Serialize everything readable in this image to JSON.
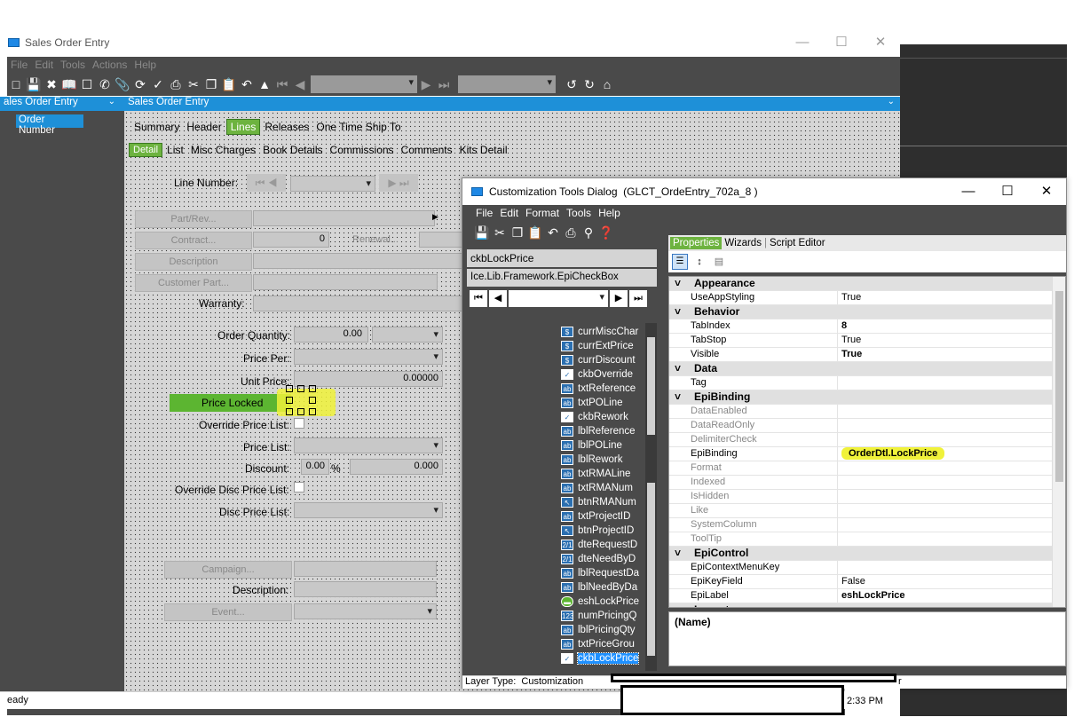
{
  "main_window": {
    "title": "Sales Order Entry",
    "menu": [
      "File",
      "Edit",
      "Tools",
      "Actions",
      "Help"
    ],
    "status_left": "eady"
  },
  "tree_panel": {
    "header": "ales Order Entry",
    "item": "Order Number"
  },
  "content_header": "Sales Order Entry",
  "tabs_top": [
    {
      "label": "Summary",
      "active": false
    },
    {
      "label": "Header",
      "active": false
    },
    {
      "label": "Lines",
      "active": true
    },
    {
      "label": "Releases",
      "active": false
    },
    {
      "label": "One Time Ship To",
      "active": false
    }
  ],
  "tabs_sub": [
    {
      "label": "Detail",
      "active": true
    },
    {
      "label": "List",
      "active": false
    },
    {
      "label": "Misc Charges",
      "active": false
    },
    {
      "label": "Book Details",
      "active": false
    },
    {
      "label": "Commissions",
      "active": false
    },
    {
      "label": "Comments",
      "active": false
    },
    {
      "label": "Kits Detail",
      "active": false
    }
  ],
  "form": {
    "line_number_label": "Line Number:",
    "part_rev_btn": "Part/Rev...",
    "contract_btn": "Contract...",
    "contract_value": "0",
    "renewal_btn": "Renewal...",
    "description_btn": "Description",
    "customer_part_btn": "Customer Part...",
    "warranty_label": "Warranty:",
    "order_qty_label": "Order Quantity:",
    "order_qty_value": "0.00",
    "price_per_label": "Price Per:",
    "unit_price_label": "Unit Price:",
    "unit_price_value": "0.00000",
    "price_locked": "Price Locked",
    "override_price_list_label": "Override Price List:",
    "price_list_label": "Price List:",
    "discount_label": "Discount:",
    "discount_pct": "0.00",
    "discount_pct_sign": "%",
    "discount_value": "0.000",
    "override_disc_label": "Override Disc Price List:",
    "disc_price_list_label": "Disc Price List:",
    "campaign_btn": "Campaign...",
    "description_label": "Description:",
    "event_btn": "Event..."
  },
  "dialog": {
    "title": "Customization Tools Dialog  (GLCT_OrdeEntry_702a_8 )",
    "menu": [
      "File",
      "Edit",
      "Format",
      "Tools",
      "Help"
    ],
    "control_name": "ckbLockPrice",
    "control_type": "Ice.Lib.Framework.EpiCheckBox",
    "tabs": [
      {
        "label": "Properties",
        "active": true
      },
      {
        "label": "Wizards",
        "active": false
      },
      {
        "label": "Script Editor",
        "active": false
      }
    ],
    "tree": [
      {
        "icon": "$",
        "label": "currMiscChar"
      },
      {
        "icon": "$",
        "label": "currExtPrice"
      },
      {
        "icon": "$",
        "label": "currDiscount"
      },
      {
        "icon": "✓",
        "label": "ckbOverride"
      },
      {
        "icon": "ab",
        "label": "txtReference"
      },
      {
        "icon": "ab",
        "label": "txtPOLine"
      },
      {
        "icon": "✓",
        "label": "ckbRework"
      },
      {
        "icon": "ab",
        "label": "lblReference"
      },
      {
        "icon": "ab",
        "label": "lblPOLine"
      },
      {
        "icon": "ab",
        "label": "lblRework"
      },
      {
        "icon": "ab",
        "label": "txtRMALine"
      },
      {
        "icon": "ab",
        "label": "txtRMANum"
      },
      {
        "icon": "↖",
        "label": "btnRMANum"
      },
      {
        "icon": "ab",
        "label": "txtProjectID"
      },
      {
        "icon": "↖",
        "label": "btnProjectID"
      },
      {
        "icon": "2/1",
        "label": "dteRequestD"
      },
      {
        "icon": "2/1",
        "label": "dteNeedByD"
      },
      {
        "icon": "ab",
        "label": "lblRequestDa"
      },
      {
        "icon": "ab",
        "label": "lblNeedByDa"
      },
      {
        "icon": "▬",
        "label": "eshLockPrice"
      },
      {
        "icon": "123",
        "label": "numPricingQ"
      },
      {
        "icon": "ab",
        "label": "lblPricingQty"
      },
      {
        "icon": "ab",
        "label": "txtPriceGrou"
      },
      {
        "icon": "✓",
        "label": "ckbLockPrice",
        "selected": true
      }
    ],
    "properties": [
      {
        "cat": "Appearance"
      },
      {
        "k": "UseAppStyling",
        "v": "True"
      },
      {
        "cat": "Behavior"
      },
      {
        "k": "TabIndex",
        "v": "8",
        "bold": true
      },
      {
        "k": "TabStop",
        "v": "True"
      },
      {
        "k": "Visible",
        "v": "True",
        "bold": true
      },
      {
        "cat": "Data"
      },
      {
        "k": "Tag",
        "v": ""
      },
      {
        "cat": "EpiBinding"
      },
      {
        "k": "DataEnabled",
        "v": "",
        "dis": true
      },
      {
        "k": "DataReadOnly",
        "v": "",
        "dis": true
      },
      {
        "k": "DelimiterCheck",
        "v": "",
        "dis": true
      },
      {
        "k": "EpiBinding",
        "v": "OrderDtl.LockPrice",
        "bold": true,
        "hl": true
      },
      {
        "k": "Format",
        "v": "",
        "dis": true
      },
      {
        "k": "Indexed",
        "v": "",
        "dis": true
      },
      {
        "k": "IsHidden",
        "v": "",
        "dis": true
      },
      {
        "k": "Like",
        "v": "",
        "dis": true
      },
      {
        "k": "SystemColumn",
        "v": "",
        "dis": true
      },
      {
        "k": "ToolTip",
        "v": "",
        "dis": true
      },
      {
        "cat": "EpiControl"
      },
      {
        "k": "EpiContextMenuKey",
        "v": ""
      },
      {
        "k": "EpiKeyField",
        "v": "False"
      },
      {
        "k": "EpiLabel",
        "v": "eshLockPrice",
        "bold": true
      },
      {
        "cat": "Layout"
      }
    ],
    "desc_title": "(Name)",
    "status": "Layer Type:  Customization",
    "status_r": "r"
  },
  "taskbar": {
    "time": "2:33 PM"
  }
}
